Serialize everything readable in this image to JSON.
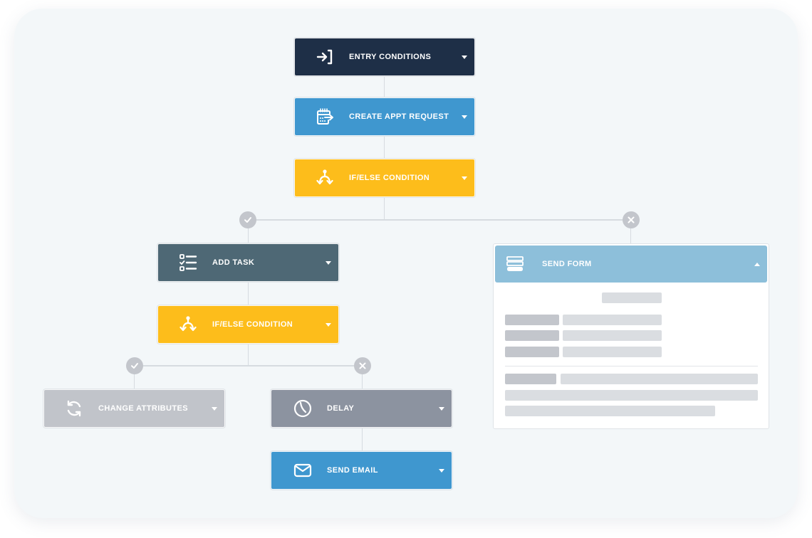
{
  "workflow": {
    "nodes": {
      "entry": {
        "label": "ENTRY CONDITIONS",
        "icon": "entry-arrow-icon",
        "color": "#1e2f47"
      },
      "create_appt": {
        "label": "CREATE APPT REQUEST",
        "icon": "calendar-arrow-icon",
        "color": "#3f97cf"
      },
      "if_else_1": {
        "label": "IF/ELSE CONDITION",
        "icon": "branch-icon",
        "color": "#fdbd1b"
      },
      "add_task": {
        "label": "ADD TASK",
        "icon": "checklist-icon",
        "color": "#4e6875"
      },
      "if_else_2": {
        "label": "IF/ELSE CONDITION",
        "icon": "branch-icon",
        "color": "#fdbd1b"
      },
      "change_attributes": {
        "label": "CHANGE ATTRIBUTES",
        "icon": "refresh-icon",
        "color": "#c1c4ca"
      },
      "delay": {
        "label": "DELAY",
        "icon": "clock-icon",
        "color": "#8c93a0"
      },
      "send_email": {
        "label": "SEND EMAIL",
        "icon": "envelope-icon",
        "color": "#3f97cf"
      },
      "send_form": {
        "label": "SEND FORM",
        "icon": "form-icon",
        "color": "#8dbfda",
        "expanded": true
      }
    },
    "branches": {
      "yes_badge": "check-icon",
      "no_badge": "x-icon"
    }
  }
}
